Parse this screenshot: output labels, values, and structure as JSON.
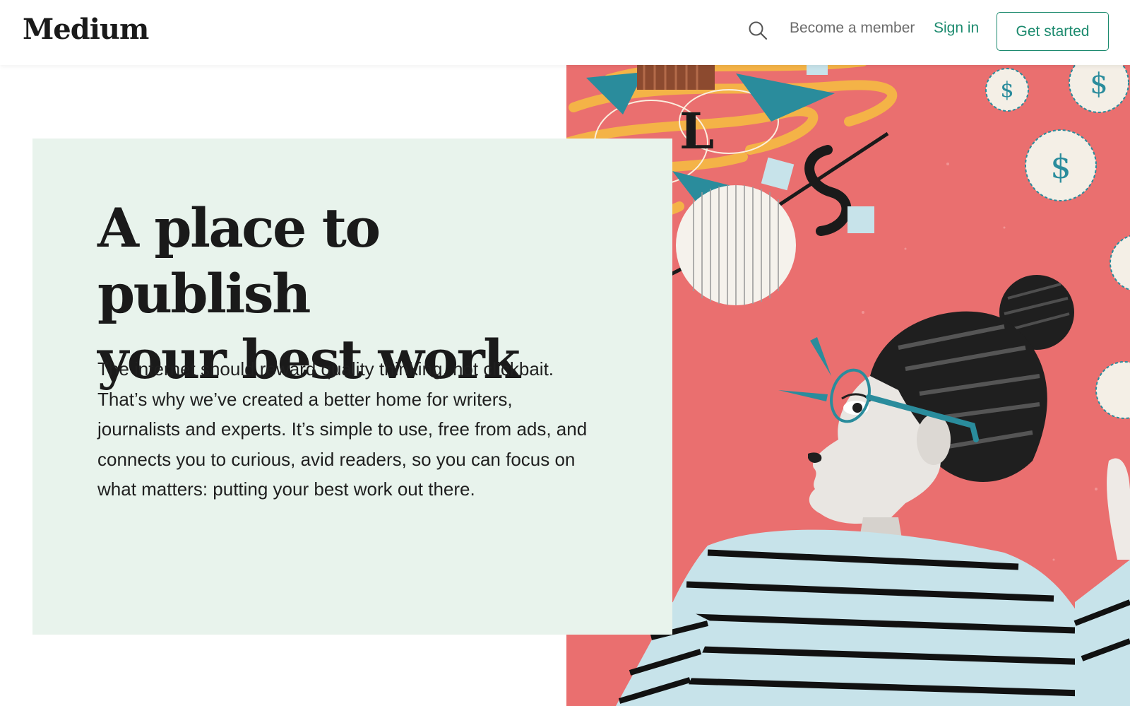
{
  "header": {
    "logo": "Medium",
    "become_member": "Become a member",
    "sign_in": "Sign in",
    "get_started": "Get started",
    "search_icon": "search-icon"
  },
  "hero": {
    "headline_line1": "A place to publish",
    "headline_line2": "your best work",
    "body_lines": [
      "The internet should reward quality thinking, not clickbait.",
      "That’s why we’ve created a better home for writers,",
      "journalists and experts. It’s simple to use, free from ads, and",
      "connects you to curious, avid readers, so you can focus on",
      "what matters: putting your best work out there."
    ]
  },
  "colors": {
    "accent_green": "#1c8a6e",
    "card_bg": "#e8f3ec",
    "illustration_bg": "#ea6f6f",
    "teal": "#2a8c9c"
  }
}
